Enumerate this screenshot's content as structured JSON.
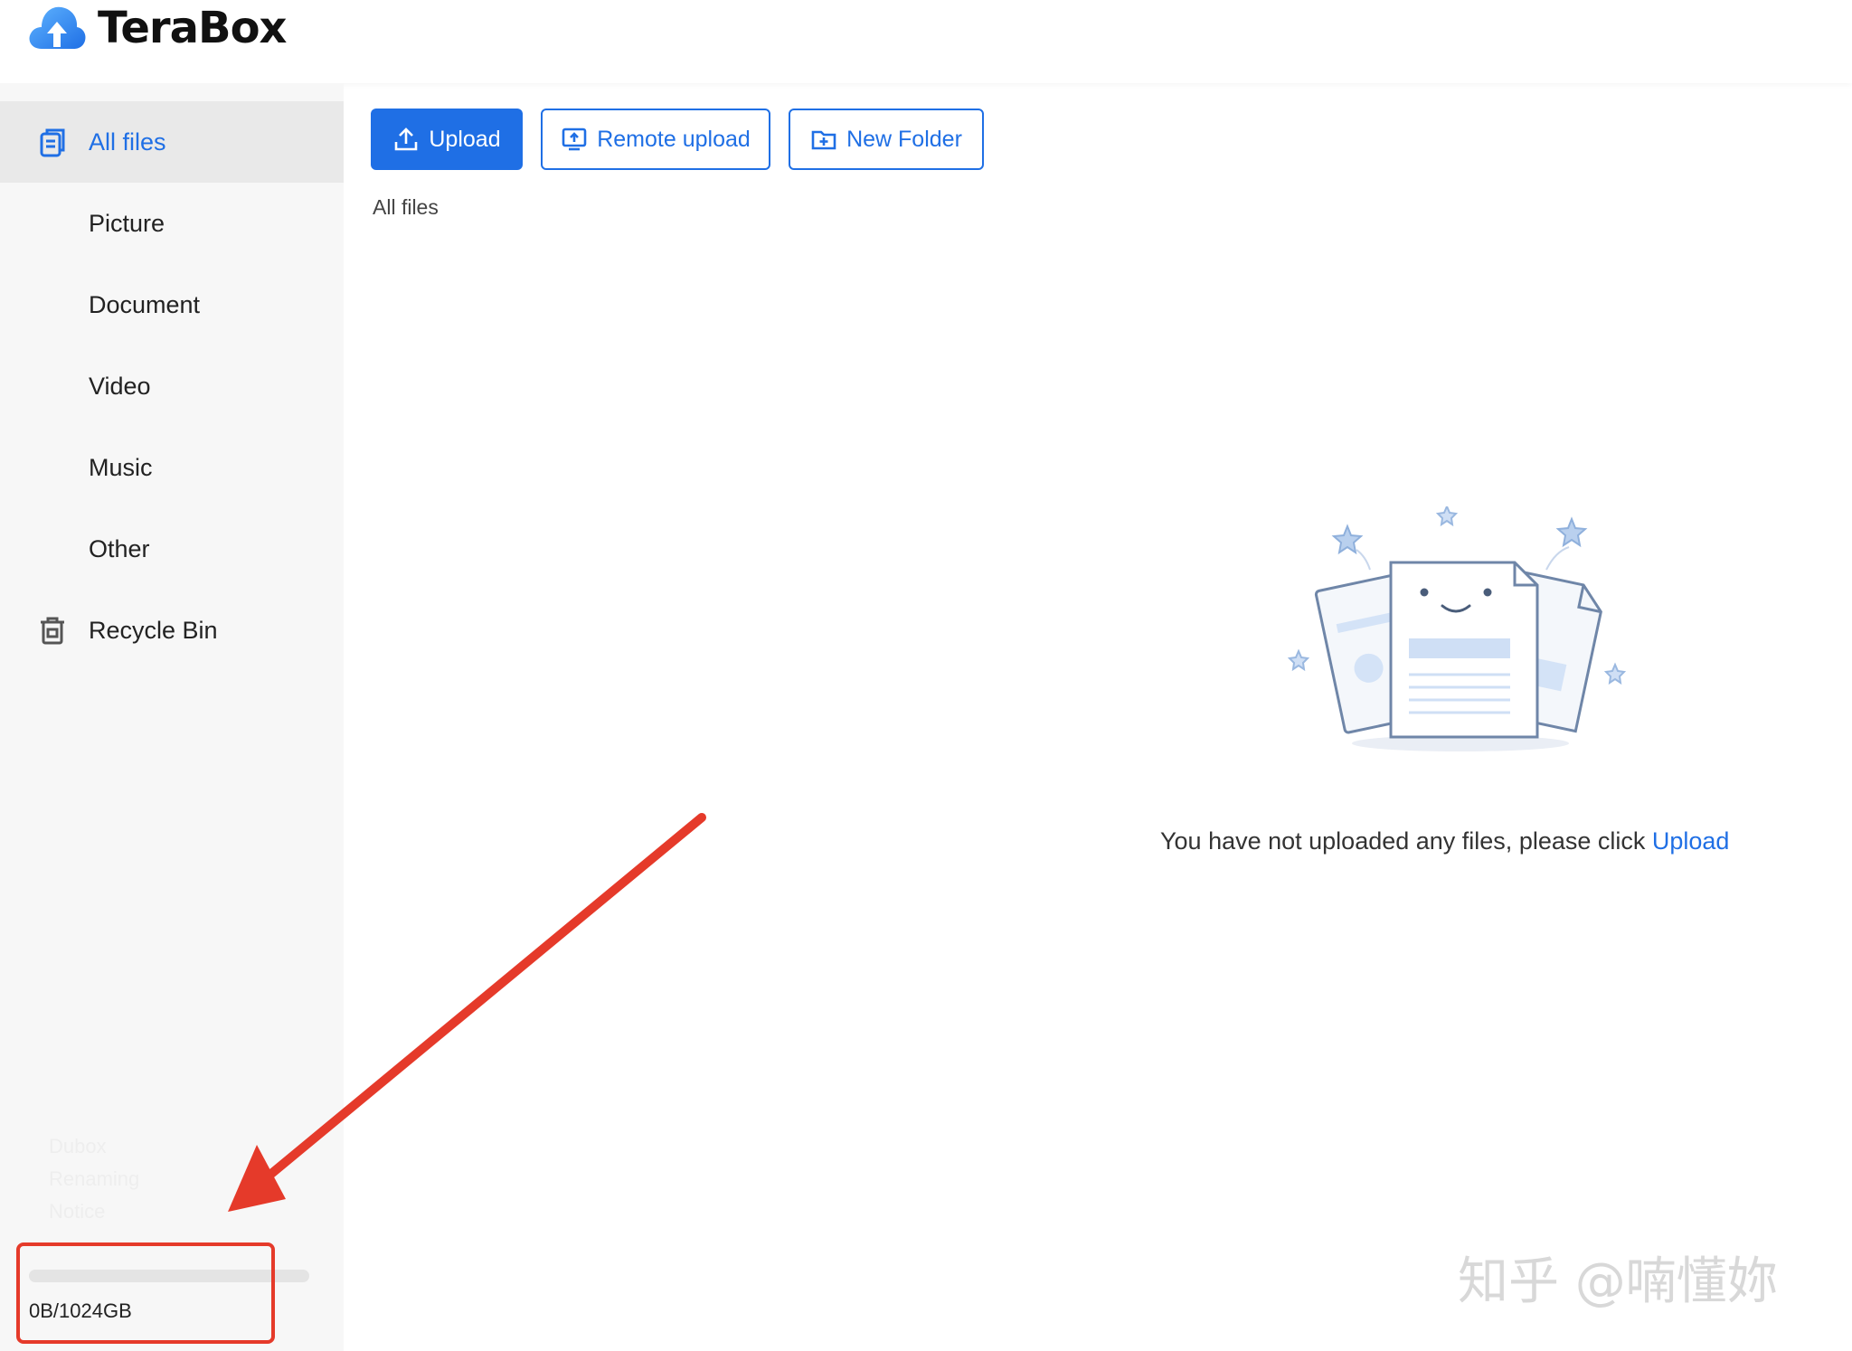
{
  "app": {
    "name": "TeraBox",
    "accent_color": "#1f6fe5"
  },
  "sidebar": {
    "items": [
      {
        "label": "All files",
        "icon": "files-icon",
        "active": true
      },
      {
        "label": "Picture",
        "icon": "",
        "active": false
      },
      {
        "label": "Document",
        "icon": "",
        "active": false
      },
      {
        "label": "Video",
        "icon": "",
        "active": false
      },
      {
        "label": "Music",
        "icon": "",
        "active": false
      },
      {
        "label": "Other",
        "icon": "",
        "active": false
      },
      {
        "label": "Recycle Bin",
        "icon": "trash-icon",
        "active": false
      }
    ],
    "notice": {
      "line1": "Dubox",
      "line2": "Renaming",
      "line3": "Notice"
    },
    "storage": {
      "text": "0B/1024GB",
      "used_fraction": 0
    }
  },
  "toolbar": {
    "upload_label": "Upload",
    "remote_upload_label": "Remote upload",
    "new_folder_label": "New Folder"
  },
  "breadcrumb": "All files",
  "empty_state": {
    "message": "You have not uploaded any files, please click ",
    "link": "Upload"
  },
  "annotation": {
    "arrow_color": "#e53a2a",
    "highlight_color": "#e53a2a"
  },
  "watermark": "知乎 @喃懂妳"
}
